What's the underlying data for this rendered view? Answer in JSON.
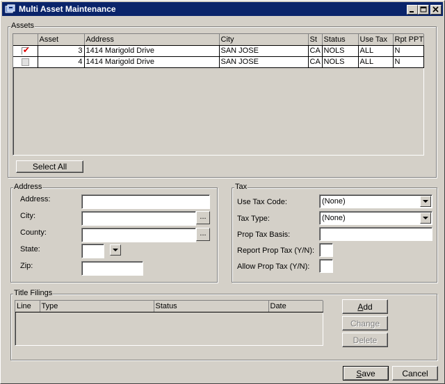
{
  "window": {
    "title": "Multi Asset Maintenance",
    "icon": "app-icon",
    "controls": [
      "minimize-icon",
      "maximize-icon",
      "close-icon"
    ]
  },
  "assets": {
    "group_label": "Assets",
    "columns": [
      "Asset",
      "Address",
      "City",
      "St",
      "Status",
      "Use Tax",
      "Rpt PPT"
    ],
    "rows": [
      {
        "checked": true,
        "asset": "3",
        "address": "1414 Marigold Drive",
        "city": "SAN JOSE",
        "st": "CA",
        "status": "NOLS",
        "use_tax": "ALL",
        "rpt_ppt": "N"
      },
      {
        "checked": false,
        "asset": "4",
        "address": "1414 Marigold Drive",
        "city": "SAN JOSE",
        "st": "CA",
        "status": "NOLS",
        "use_tax": "ALL",
        "rpt_ppt": "N"
      }
    ],
    "select_all_label": "Select All"
  },
  "address": {
    "group_label": "Address",
    "address_label": "Address:",
    "address_value": "",
    "city_label": "City:",
    "city_value": "",
    "county_label": "County:",
    "county_value": "",
    "state_label": "State:",
    "state_value": "",
    "zip_label": "Zip:",
    "zip_value": "",
    "ellipsis": "..."
  },
  "tax": {
    "group_label": "Tax",
    "use_tax_code_label": "Use Tax Code:",
    "use_tax_code_value": "(None)",
    "tax_type_label": "Tax Type:",
    "tax_type_value": "(None)",
    "prop_tax_basis_label": "Prop Tax Basis:",
    "prop_tax_basis_value": "",
    "report_prop_tax_label": "Report Prop Tax (Y/N):",
    "report_prop_tax_value": "",
    "allow_prop_tax_label": "Allow Prop Tax (Y/N):",
    "allow_prop_tax_value": ""
  },
  "title_filings": {
    "group_label": "Title Filings",
    "columns": [
      "Line",
      "Type",
      "Status",
      "Date"
    ],
    "add_label_u": "A",
    "add_label_rest": "dd",
    "change_label": "Change",
    "delete_label": "Delete"
  },
  "footer": {
    "save_label_u": "S",
    "save_label_rest": "ave",
    "cancel_label": "Cancel"
  }
}
